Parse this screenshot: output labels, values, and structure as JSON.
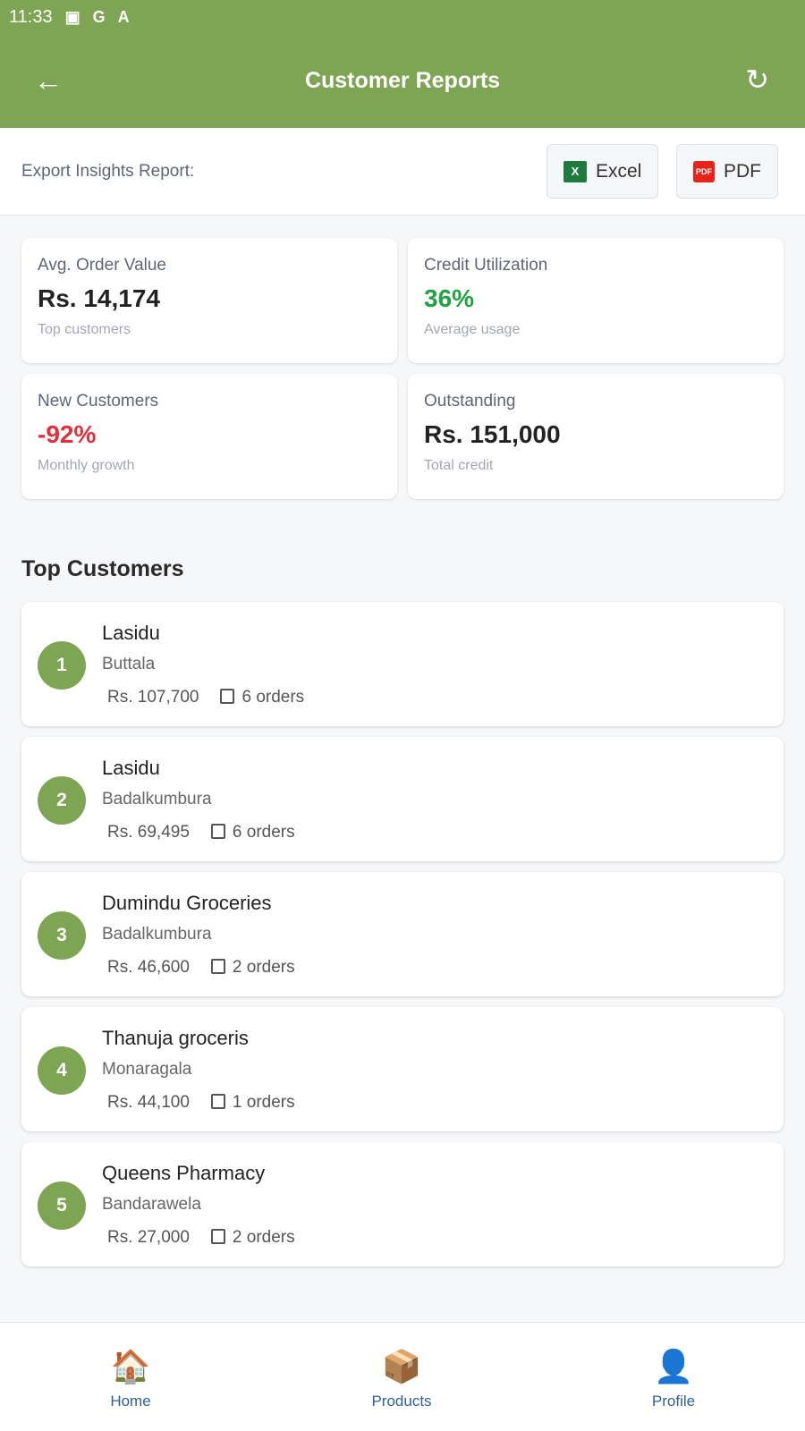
{
  "status_bar": {
    "time": "11:33",
    "icons": [
      "image-icon",
      "google-icon",
      "font-icon"
    ]
  },
  "header": {
    "title": "Customer Reports"
  },
  "export": {
    "label": "Export Insights Report:",
    "excel": "Excel",
    "pdf": "PDF",
    "excel_icon_text": "X",
    "pdf_icon_text": "PDF"
  },
  "stats": [
    {
      "label": "Avg. Order Value",
      "value": "Rs. 14,174",
      "sub": "Top customers",
      "color": "#222222"
    },
    {
      "label": "Credit Utilization",
      "value": "36%",
      "sub": "Average usage",
      "color": "#22a244"
    },
    {
      "label": "New Customers",
      "value": "-92%",
      "sub": "Monthly growth",
      "color": "#e0303e"
    },
    {
      "label": "Outstanding",
      "value": "Rs. 151,000",
      "sub": "Total credit",
      "color": "#222222"
    }
  ],
  "top_customers": {
    "title": "Top Customers",
    "items": [
      {
        "rank": "1",
        "name": "Lasidu",
        "location": "Buttala",
        "amount": "Rs. 107,700",
        "orders": "6 orders"
      },
      {
        "rank": "2",
        "name": "Lasidu",
        "location": "Badalkumbura",
        "amount": "Rs. 69,495",
        "orders": "6 orders"
      },
      {
        "rank": "3",
        "name": "Dumindu Groceries",
        "location": "Badalkumbura",
        "amount": "Rs. 46,600",
        "orders": "2 orders"
      },
      {
        "rank": "4",
        "name": "Thanuja groceris",
        "location": "Monaragala",
        "amount": "Rs. 44,100",
        "orders": "1 orders"
      },
      {
        "rank": "5",
        "name": "Queens Pharmacy",
        "location": "Bandarawela",
        "amount": "Rs. 27,000",
        "orders": "2 orders"
      }
    ]
  },
  "nav": [
    {
      "label": "Home",
      "icon": "🏠"
    },
    {
      "label": "Products",
      "icon": "📦"
    },
    {
      "label": "Profile",
      "icon": "👤"
    }
  ]
}
